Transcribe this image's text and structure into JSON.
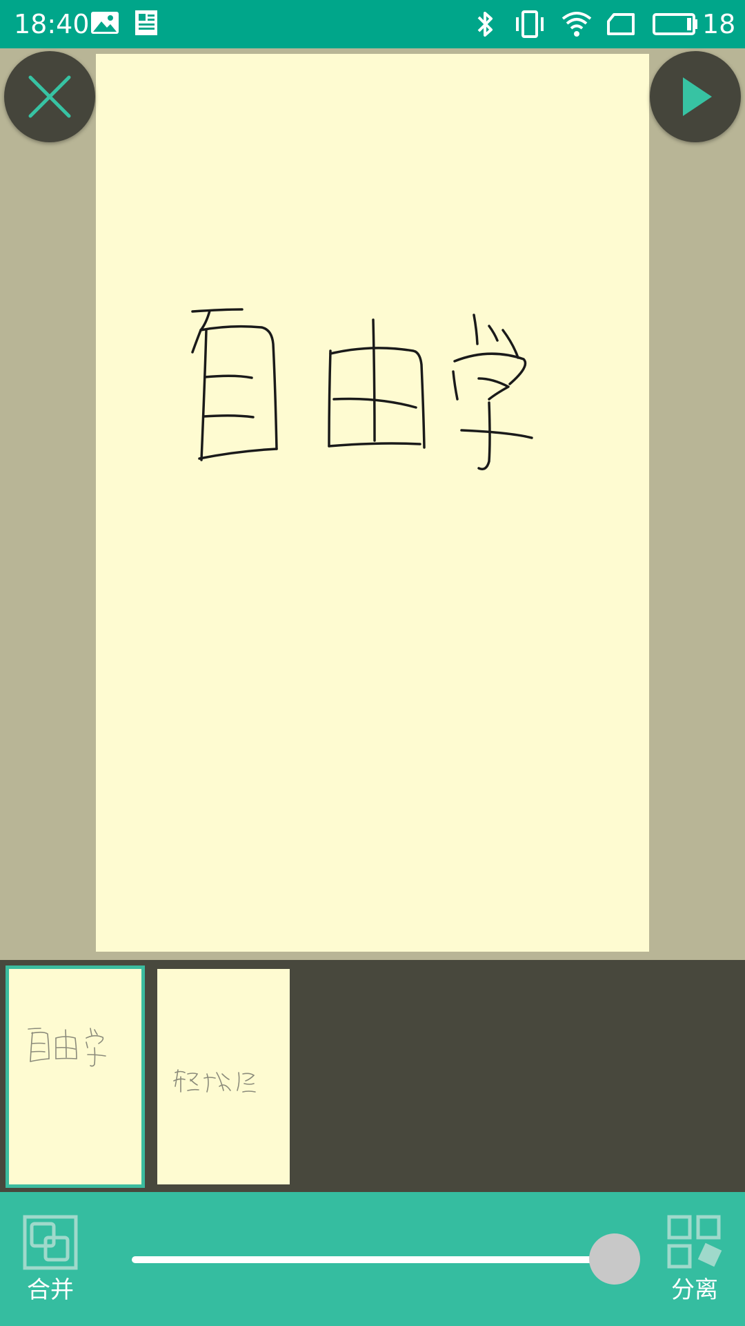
{
  "status_bar": {
    "time": "18:40",
    "icons": [
      "image-icon",
      "news-icon",
      "bluetooth-icon",
      "vibrate-icon",
      "wifi-icon",
      "sim-icon",
      "battery-icon"
    ],
    "battery_level": "18"
  },
  "canvas": {
    "handwritten_text": "自由学",
    "close_icon": "close-icon",
    "play_icon": "play-icon"
  },
  "pages": {
    "items": [
      {
        "text": "自由学",
        "selected": true
      },
      {
        "text": "轻松学",
        "selected": false
      }
    ]
  },
  "toolbar": {
    "merge_label": "合并",
    "merge_icon": "merge-icon",
    "split_label": "分离",
    "split_icon": "split-icon",
    "slider_value": 1.0
  },
  "colors": {
    "status_bar": "#00a68a",
    "accent": "#35bda0",
    "paper": "#fefbd1",
    "workspace": "#b8b596",
    "strip": "#48483d"
  }
}
